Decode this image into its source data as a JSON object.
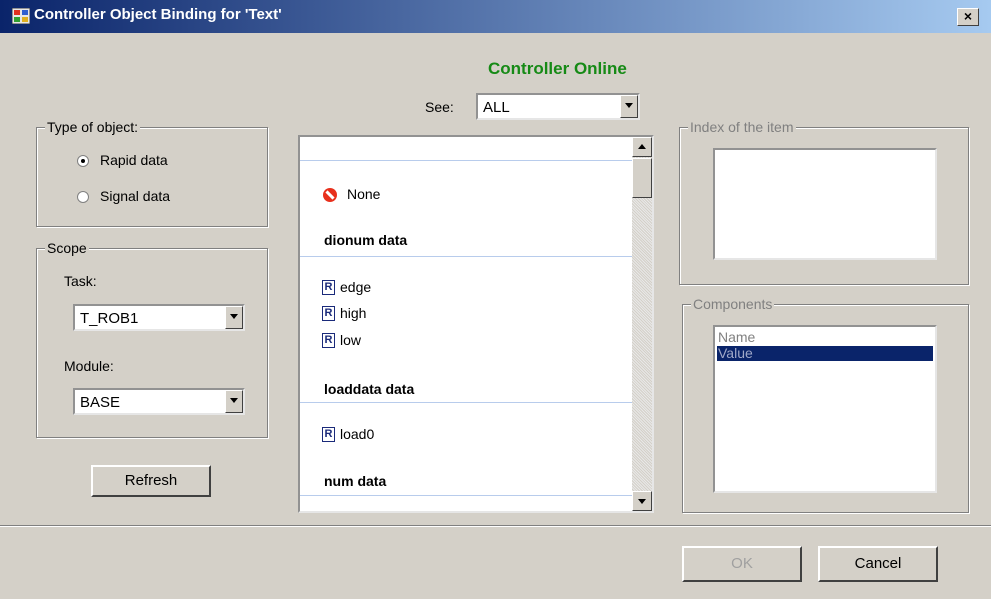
{
  "window": {
    "title": "Controller Object Binding for 'Text'",
    "close_glyph": "×"
  },
  "status": {
    "text": "Controller Online",
    "color": "#168a16"
  },
  "see": {
    "label": "See:",
    "value": "ALL"
  },
  "type_group": {
    "legend": "Type of object:",
    "options": [
      {
        "label": "Rapid data",
        "selected": true
      },
      {
        "label": "Signal data",
        "selected": false
      }
    ]
  },
  "scope": {
    "legend": "Scope",
    "task_label": "Task:",
    "task_value": "T_ROB1",
    "module_label": "Module:",
    "module_value": "BASE"
  },
  "refresh_label": "Refresh",
  "list": {
    "none_label": "None",
    "groups": [
      {
        "header": "dionum data",
        "items": [
          "edge",
          "high",
          "low"
        ]
      },
      {
        "header": "loaddata data",
        "items": [
          "load0"
        ]
      },
      {
        "header": "num data",
        "items": []
      }
    ],
    "item_icon": "R"
  },
  "index_group": {
    "legend": "Index of the item"
  },
  "components": {
    "legend": "Components",
    "items": [
      "Name",
      "Value"
    ],
    "selected_index": 1
  },
  "buttons": {
    "ok": "OK",
    "cancel": "Cancel"
  },
  "icons": [
    "app-icon",
    "close-icon",
    "no-entry-icon",
    "rapid-data-icon",
    "dropdown-arrow-icon",
    "scroll-up-icon",
    "scroll-down-icon"
  ]
}
